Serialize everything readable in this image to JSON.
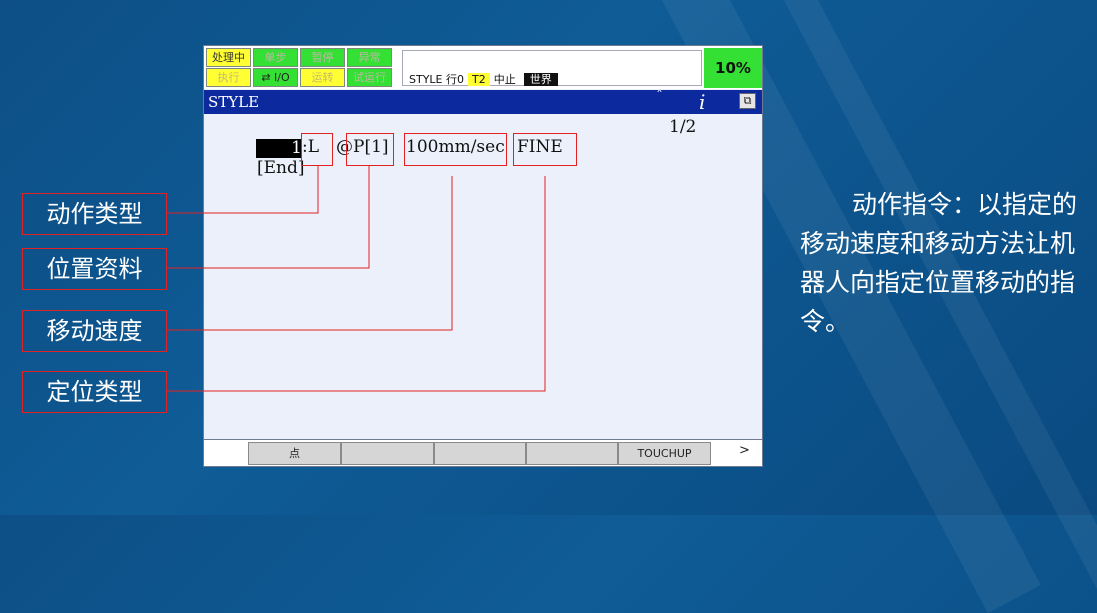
{
  "status": {
    "row1": [
      "处理中",
      "单步",
      "暂停",
      "异常"
    ],
    "row2": [
      "执行",
      "I/O",
      "运转",
      "试运行"
    ],
    "info_prefix": "STYLE 行0",
    "mode": "T2",
    "state": "中止",
    "frame": "世界",
    "override": "10%"
  },
  "title_bar": {
    "title": "STYLE",
    "caret": "ˆ",
    "info": "i"
  },
  "page_indicator": "1/2",
  "program": {
    "line_number": "1",
    "motion_type": ":L",
    "position": "@P[1]",
    "speed": "100mm/sec",
    "termination": "FINE",
    "end": "[End]"
  },
  "softkeys": [
    "",
    "点",
    "",
    "",
    "",
    "TOUCHUP"
  ],
  "next_arrow": ">",
  "callouts": [
    "动作类型",
    "位置资料",
    "移动速度",
    "定位类型"
  ],
  "description": "动作指令：以指定的移动速度和移动方法让机器人向指定位置移动的指令。",
  "colors": {
    "background": "#0f5c97",
    "highlight_box": "#e02222",
    "title_bar": "#0c2a9e",
    "status_green": "#33e033",
    "status_yellow": "#ffff33"
  }
}
